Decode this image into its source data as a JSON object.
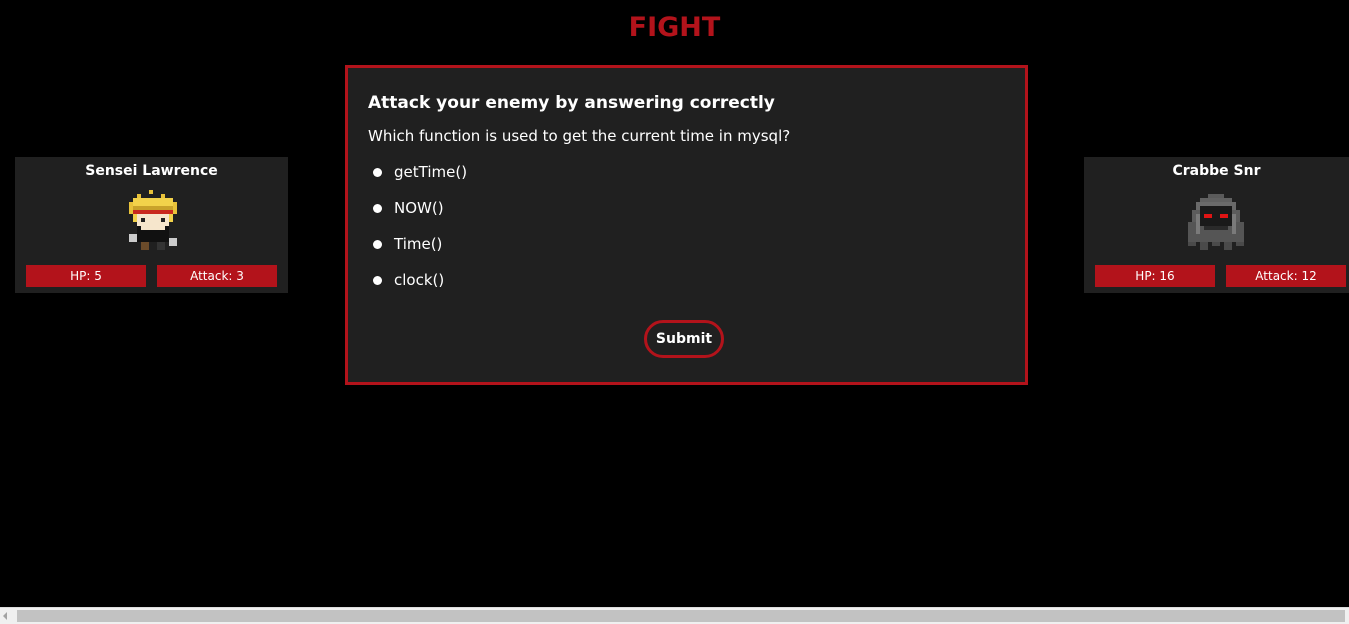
{
  "title": "FIGHT",
  "player": {
    "name": "Sensei Lawrence",
    "hp_label": "HP: 5",
    "attack_label": "Attack: 3",
    "sprite_icon": "blond-fighter-sprite"
  },
  "enemy": {
    "name": "Crabbe Snr",
    "hp_label": "HP: 16",
    "attack_label": "Attack: 12",
    "sprite_icon": "hooded-red-eyed-ghost-sprite"
  },
  "quiz": {
    "heading": "Attack your enemy by answering correctly",
    "question": "Which function is used to get the current time in mysql?",
    "options": [
      "getTime()",
      "NOW()",
      "Time()",
      "clock()"
    ],
    "submit_label": "Submit"
  },
  "colors": {
    "accent": "#b3131b",
    "panel_bg": "#202020",
    "page_bg": "#000000"
  }
}
